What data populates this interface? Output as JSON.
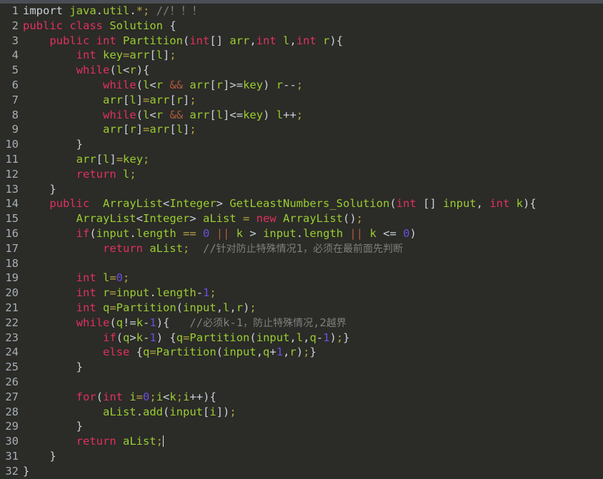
{
  "editor": {
    "title_bar_color": "#4a4f55",
    "background_color": "#2b2b27",
    "gutter_color": "#a6b0b8",
    "language": "java",
    "caret_line": 30,
    "total_lines": 32,
    "theme": {
      "keyword": "#e0315f",
      "identifier": "#9acd32",
      "number": "#6a4fe0",
      "comment": "#7f7f7f",
      "punctuation": "#c9d1d9",
      "operator": "#b5a642"
    }
  },
  "lines": [
    {
      "n": "1",
      "text": "import java.util.*; //！！！"
    },
    {
      "n": "2",
      "text": "public class Solution {"
    },
    {
      "n": "3",
      "text": "    public int Partition(int[] arr,int l,int r){"
    },
    {
      "n": "4",
      "text": "        int key=arr[l];"
    },
    {
      "n": "5",
      "text": "        while(l<r){"
    },
    {
      "n": "6",
      "text": "            while(l<r && arr[r]>=key) r--;"
    },
    {
      "n": "7",
      "text": "            arr[l]=arr[r];"
    },
    {
      "n": "8",
      "text": "            while(l<r && arr[l]<=key) l++;"
    },
    {
      "n": "9",
      "text": "            arr[r]=arr[l];"
    },
    {
      "n": "10",
      "text": "        }"
    },
    {
      "n": "11",
      "text": "        arr[l]=key;"
    },
    {
      "n": "12",
      "text": "        return l;"
    },
    {
      "n": "13",
      "text": "    }"
    },
    {
      "n": "14",
      "text": "    public  ArrayList<Integer> GetLeastNumbers_Solution(int [] input, int k){"
    },
    {
      "n": "15",
      "text": "        ArrayList<Integer> aList = new ArrayList();"
    },
    {
      "n": "16",
      "text": "        if(input.length == 0 || k > input.length || k <= 0)"
    },
    {
      "n": "17",
      "text": "            return aList;  //针对防止特殊情况1，必须在最前面先判断"
    },
    {
      "n": "18",
      "text": ""
    },
    {
      "n": "19",
      "text": "        int l=0;"
    },
    {
      "n": "20",
      "text": "        int r=input.length-1;"
    },
    {
      "n": "21",
      "text": "        int q=Partition(input,l,r);"
    },
    {
      "n": "22",
      "text": "        while(q!=k-1){   //必须k-1，防止特殊情况,2越界"
    },
    {
      "n": "23",
      "text": "            if(q>k-1) {q=Partition(input,l,q-1);}"
    },
    {
      "n": "24",
      "text": "            else {q=Partition(input,q+1,r);}"
    },
    {
      "n": "25",
      "text": "        }"
    },
    {
      "n": "26",
      "text": ""
    },
    {
      "n": "27",
      "text": "        for(int i=0;i<k;i++){"
    },
    {
      "n": "28",
      "text": "            aList.add(input[i]);"
    },
    {
      "n": "29",
      "text": "        }"
    },
    {
      "n": "30",
      "text": "        return aList;"
    },
    {
      "n": "31",
      "text": "    }"
    },
    {
      "n": "32",
      "text": "}"
    }
  ],
  "rendered": {
    "l1": [
      [
        "pun",
        "import "
      ],
      [
        "id",
        "java"
      ],
      [
        "pun",
        "."
      ],
      [
        "id",
        "util"
      ],
      [
        "pun",
        "."
      ],
      [
        "op",
        "*"
      ],
      [
        "op",
        ";"
      ],
      [
        "cmt",
        " //！！！"
      ]
    ],
    "l2": [
      [
        "kw",
        "public "
      ],
      [
        "kw",
        "class "
      ],
      [
        "id",
        "Solution "
      ],
      [
        "pun",
        "{"
      ]
    ],
    "l3": [
      [
        "pun",
        "    "
      ],
      [
        "kw",
        "public "
      ],
      [
        "kw",
        "int "
      ],
      [
        "id",
        "Partition"
      ],
      [
        "pun",
        "("
      ],
      [
        "kw",
        "int"
      ],
      [
        "pun",
        "[] "
      ],
      [
        "id",
        "arr"
      ],
      [
        "pun",
        ","
      ],
      [
        "kw",
        "int "
      ],
      [
        "id",
        "l"
      ],
      [
        "pun",
        ","
      ],
      [
        "kw",
        "int "
      ],
      [
        "id",
        "r"
      ],
      [
        "pun",
        ")"
      ],
      [
        "pun",
        "{"
      ]
    ],
    "l4": [
      [
        "pun",
        "        "
      ],
      [
        "kw",
        "int "
      ],
      [
        "id",
        "key"
      ],
      [
        "op",
        "="
      ],
      [
        "id",
        "arr"
      ],
      [
        "pun",
        "["
      ],
      [
        "id",
        "l"
      ],
      [
        "pun",
        "]"
      ],
      [
        "op",
        ";"
      ]
    ],
    "l5": [
      [
        "pun",
        "        "
      ],
      [
        "kw",
        "while"
      ],
      [
        "pun",
        "("
      ],
      [
        "id",
        "l"
      ],
      [
        "pun",
        "<"
      ],
      [
        "id",
        "r"
      ],
      [
        "pun",
        ")"
      ],
      [
        "pun",
        "{"
      ]
    ],
    "l6": [
      [
        "pun",
        "            "
      ],
      [
        "kw",
        "while"
      ],
      [
        "pun",
        "("
      ],
      [
        "id",
        "l"
      ],
      [
        "pun",
        "<"
      ],
      [
        "id",
        "r"
      ],
      [
        "pun",
        " "
      ],
      [
        "or",
        "&&"
      ],
      [
        "pun",
        " "
      ],
      [
        "id",
        "arr"
      ],
      [
        "pun",
        "["
      ],
      [
        "id",
        "r"
      ],
      [
        "pun",
        "]"
      ],
      [
        "pun",
        ">="
      ],
      [
        "id",
        "key"
      ],
      [
        "pun",
        ") "
      ],
      [
        "id",
        "r"
      ],
      [
        "pun",
        "--"
      ],
      [
        "op",
        ";"
      ]
    ],
    "l7": [
      [
        "pun",
        "            "
      ],
      [
        "id",
        "arr"
      ],
      [
        "pun",
        "["
      ],
      [
        "id",
        "l"
      ],
      [
        "pun",
        "]"
      ],
      [
        "op",
        "="
      ],
      [
        "id",
        "arr"
      ],
      [
        "pun",
        "["
      ],
      [
        "id",
        "r"
      ],
      [
        "pun",
        "]"
      ],
      [
        "op",
        ";"
      ]
    ],
    "l8": [
      [
        "pun",
        "            "
      ],
      [
        "kw",
        "while"
      ],
      [
        "pun",
        "("
      ],
      [
        "id",
        "l"
      ],
      [
        "pun",
        "<"
      ],
      [
        "id",
        "r"
      ],
      [
        "pun",
        " "
      ],
      [
        "or",
        "&&"
      ],
      [
        "pun",
        " "
      ],
      [
        "id",
        "arr"
      ],
      [
        "pun",
        "["
      ],
      [
        "id",
        "l"
      ],
      [
        "pun",
        "]"
      ],
      [
        "pun",
        "<="
      ],
      [
        "id",
        "key"
      ],
      [
        "pun",
        ") "
      ],
      [
        "id",
        "l"
      ],
      [
        "pun",
        "++"
      ],
      [
        "op",
        ";"
      ]
    ],
    "l9": [
      [
        "pun",
        "            "
      ],
      [
        "id",
        "arr"
      ],
      [
        "pun",
        "["
      ],
      [
        "id",
        "r"
      ],
      [
        "pun",
        "]"
      ],
      [
        "op",
        "="
      ],
      [
        "id",
        "arr"
      ],
      [
        "pun",
        "["
      ],
      [
        "id",
        "l"
      ],
      [
        "pun",
        "]"
      ],
      [
        "op",
        ";"
      ]
    ],
    "l10": [
      [
        "pun",
        "        }"
      ]
    ],
    "l11": [
      [
        "pun",
        "        "
      ],
      [
        "id",
        "arr"
      ],
      [
        "pun",
        "["
      ],
      [
        "id",
        "l"
      ],
      [
        "pun",
        "]"
      ],
      [
        "op",
        "="
      ],
      [
        "id",
        "key"
      ],
      [
        "op",
        ";"
      ]
    ],
    "l12": [
      [
        "pun",
        "        "
      ],
      [
        "kw",
        "return "
      ],
      [
        "id",
        "l"
      ],
      [
        "op",
        ";"
      ]
    ],
    "l13": [
      [
        "pun",
        "    }"
      ]
    ],
    "l14": [
      [
        "pun",
        "    "
      ],
      [
        "kw",
        "public"
      ],
      [
        "pun",
        "  "
      ],
      [
        "id",
        "ArrayList"
      ],
      [
        "pun",
        "<"
      ],
      [
        "id",
        "Integer"
      ],
      [
        "pun",
        "> "
      ],
      [
        "id",
        "GetLeastNumbers_Solution"
      ],
      [
        "pun",
        "("
      ],
      [
        "kw",
        "int "
      ],
      [
        "pun",
        "[] "
      ],
      [
        "id",
        "input"
      ],
      [
        "pun",
        ", "
      ],
      [
        "kw",
        "int "
      ],
      [
        "id",
        "k"
      ],
      [
        "pun",
        ")"
      ],
      [
        "pun",
        "{"
      ]
    ],
    "l15": [
      [
        "pun",
        "        "
      ],
      [
        "id",
        "ArrayList"
      ],
      [
        "pun",
        "<"
      ],
      [
        "id",
        "Integer"
      ],
      [
        "pun",
        "> "
      ],
      [
        "id",
        "aList "
      ],
      [
        "op",
        "= "
      ],
      [
        "kw",
        "new "
      ],
      [
        "id",
        "ArrayList"
      ],
      [
        "pun",
        "()"
      ],
      [
        "op",
        ";"
      ]
    ],
    "l16": [
      [
        "pun",
        "        "
      ],
      [
        "kw",
        "if"
      ],
      [
        "pun",
        "("
      ],
      [
        "id",
        "input"
      ],
      [
        "pun",
        "."
      ],
      [
        "id",
        "length "
      ],
      [
        "op",
        "== "
      ],
      [
        "num",
        "0"
      ],
      [
        "pun",
        " "
      ],
      [
        "or",
        "||"
      ],
      [
        "pun",
        " "
      ],
      [
        "id",
        "k "
      ],
      [
        "pun",
        "> "
      ],
      [
        "id",
        "input"
      ],
      [
        "pun",
        "."
      ],
      [
        "id",
        "length"
      ],
      [
        "pun",
        " "
      ],
      [
        "or",
        "||"
      ],
      [
        "pun",
        " "
      ],
      [
        "id",
        "k "
      ],
      [
        "pun",
        "<= "
      ],
      [
        "num",
        "0"
      ],
      [
        "pun",
        ")"
      ]
    ],
    "l17": [
      [
        "pun",
        "            "
      ],
      [
        "kw",
        "return "
      ],
      [
        "id",
        "aList"
      ],
      [
        "op",
        ";"
      ],
      [
        "cmt",
        "  //"
      ],
      [
        "cn",
        "针对防止特殊情况"
      ],
      [
        "cmt",
        "1"
      ],
      [
        "cn",
        "，必须在最前面先判断"
      ]
    ],
    "l18": [],
    "l19": [
      [
        "pun",
        "        "
      ],
      [
        "kw",
        "int "
      ],
      [
        "id",
        "l"
      ],
      [
        "op",
        "="
      ],
      [
        "num",
        "0"
      ],
      [
        "op",
        ";"
      ]
    ],
    "l20": [
      [
        "pun",
        "        "
      ],
      [
        "kw",
        "int "
      ],
      [
        "id",
        "r"
      ],
      [
        "op",
        "="
      ],
      [
        "id",
        "input"
      ],
      [
        "pun",
        "."
      ],
      [
        "id",
        "length"
      ],
      [
        "pun",
        "-"
      ],
      [
        "num",
        "1"
      ],
      [
        "op",
        ";"
      ]
    ],
    "l21": [
      [
        "pun",
        "        "
      ],
      [
        "kw",
        "int "
      ],
      [
        "id",
        "q"
      ],
      [
        "op",
        "="
      ],
      [
        "id",
        "Partition"
      ],
      [
        "pun",
        "("
      ],
      [
        "id",
        "input"
      ],
      [
        "pun",
        ","
      ],
      [
        "id",
        "l"
      ],
      [
        "pun",
        ","
      ],
      [
        "id",
        "r"
      ],
      [
        "pun",
        ")"
      ],
      [
        "op",
        ";"
      ]
    ],
    "l22": [
      [
        "pun",
        "        "
      ],
      [
        "kw",
        "while"
      ],
      [
        "pun",
        "("
      ],
      [
        "id",
        "q"
      ],
      [
        "pun",
        "!="
      ],
      [
        "id",
        "k"
      ],
      [
        "pun",
        "-"
      ],
      [
        "num",
        "1"
      ],
      [
        "pun",
        ")"
      ],
      [
        "pun",
        "{"
      ],
      [
        "cmt",
        "   //"
      ],
      [
        "cn",
        "必须"
      ],
      [
        "cmt",
        "k-1"
      ],
      [
        "cn",
        "，防止特殊情况"
      ],
      [
        "cmt",
        ",2"
      ],
      [
        "cn",
        "越界"
      ]
    ],
    "l23": [
      [
        "pun",
        "            "
      ],
      [
        "kw",
        "if"
      ],
      [
        "pun",
        "("
      ],
      [
        "id",
        "q"
      ],
      [
        "pun",
        ">"
      ],
      [
        "id",
        "k"
      ],
      [
        "pun",
        "-"
      ],
      [
        "num",
        "1"
      ],
      [
        "pun",
        ") {"
      ],
      [
        "id",
        "q"
      ],
      [
        "op",
        "="
      ],
      [
        "id",
        "Partition"
      ],
      [
        "pun",
        "("
      ],
      [
        "id",
        "input"
      ],
      [
        "pun",
        ","
      ],
      [
        "id",
        "l"
      ],
      [
        "pun",
        ","
      ],
      [
        "id",
        "q"
      ],
      [
        "pun",
        "-"
      ],
      [
        "num",
        "1"
      ],
      [
        "pun",
        ")"
      ],
      [
        "op",
        ";"
      ],
      [
        "pun",
        "}"
      ]
    ],
    "l24": [
      [
        "pun",
        "            "
      ],
      [
        "kw",
        "else"
      ],
      [
        "pun",
        " {"
      ],
      [
        "id",
        "q"
      ],
      [
        "op",
        "="
      ],
      [
        "id",
        "Partition"
      ],
      [
        "pun",
        "("
      ],
      [
        "id",
        "input"
      ],
      [
        "pun",
        ","
      ],
      [
        "id",
        "q"
      ],
      [
        "pun",
        "+"
      ],
      [
        "num",
        "1"
      ],
      [
        "pun",
        ","
      ],
      [
        "id",
        "r"
      ],
      [
        "pun",
        ")"
      ],
      [
        "op",
        ";"
      ],
      [
        "pun",
        "}"
      ]
    ],
    "l25": [
      [
        "pun",
        "        }"
      ]
    ],
    "l26": [],
    "l27": [
      [
        "pun",
        "        "
      ],
      [
        "kw",
        "for"
      ],
      [
        "pun",
        "("
      ],
      [
        "kw",
        "int "
      ],
      [
        "id",
        "i"
      ],
      [
        "op",
        "="
      ],
      [
        "num",
        "0"
      ],
      [
        "op",
        ";"
      ],
      [
        "id",
        "i"
      ],
      [
        "pun",
        "<"
      ],
      [
        "id",
        "k"
      ],
      [
        "op",
        ";"
      ],
      [
        "id",
        "i"
      ],
      [
        "pun",
        "++"
      ],
      [
        "pun",
        ")"
      ],
      [
        "pun",
        "{"
      ]
    ],
    "l28": [
      [
        "pun",
        "            "
      ],
      [
        "id",
        "aList"
      ],
      [
        "pun",
        "."
      ],
      [
        "id",
        "add"
      ],
      [
        "pun",
        "("
      ],
      [
        "id",
        "input"
      ],
      [
        "pun",
        "["
      ],
      [
        "id",
        "i"
      ],
      [
        "pun",
        "]"
      ],
      [
        "pun",
        ")"
      ],
      [
        "op",
        ";"
      ]
    ],
    "l29": [
      [
        "pun",
        "        }"
      ]
    ],
    "l30": [
      [
        "pun",
        "        "
      ],
      [
        "kw",
        "return "
      ],
      [
        "id",
        "aList"
      ],
      [
        "op",
        ";"
      ]
    ],
    "l31": [
      [
        "pun",
        "    }"
      ]
    ],
    "l32": [
      [
        "pun",
        "}"
      ]
    ]
  }
}
